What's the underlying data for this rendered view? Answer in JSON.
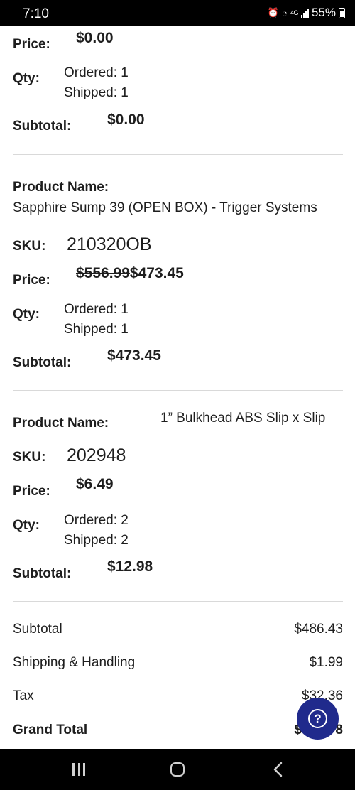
{
  "status_bar": {
    "time": "7:10",
    "network": "4G",
    "battery": "55%"
  },
  "labels": {
    "product_name": "Product Name:",
    "sku": "SKU:",
    "price": "Price:",
    "qty": "Qty:",
    "subtotal": "Subtotal:"
  },
  "items": [
    {
      "price_old": "",
      "price": "$0.00",
      "ordered": "Ordered: 1",
      "shipped": "Shipped: 1",
      "subtotal": "$0.00"
    },
    {
      "name": "Sapphire Sump 39 (OPEN BOX) - Trigger Systems",
      "sku": "210320OB",
      "price_old": "$556.99",
      "price": "$473.45",
      "ordered": "Ordered: 1",
      "shipped": "Shipped: 1",
      "subtotal": "$473.45"
    },
    {
      "name": "1” Bulkhead ABS Slip x Slip",
      "sku": "202948",
      "price": "$6.49",
      "ordered": "Ordered: 2",
      "shipped": "Shipped: 2",
      "subtotal": "$12.98"
    }
  ],
  "summary": {
    "subtotal_label": "Subtotal",
    "subtotal_value": "$486.43",
    "shipping_label": "Shipping & Handling",
    "shipping_value": "$1.99",
    "tax_label": "Tax",
    "tax_value": "$32.36",
    "grand_total_label": "Grand Total",
    "grand_total_value": "$520.78"
  },
  "help_button": {
    "icon": "question-icon",
    "symbol": "?"
  },
  "colors": {
    "help_button": "#202a8c",
    "divider": "#d9d9d9",
    "system_bars": "#000000"
  }
}
